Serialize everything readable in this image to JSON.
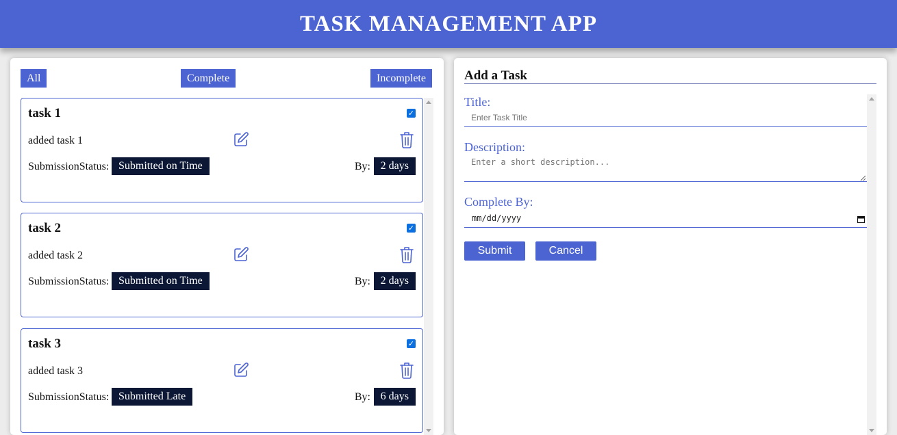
{
  "header": {
    "title": "TASK MANAGEMENT APP"
  },
  "filters": {
    "all": "All",
    "complete": "Complete",
    "incomplete": "Incomplete"
  },
  "tasks": [
    {
      "title": "task 1",
      "description": "added task 1",
      "completed": true,
      "status_label": "SubmissionStatus:",
      "status": "Submitted on Time",
      "by_label": "By:",
      "by": "2 days"
    },
    {
      "title": "task 2",
      "description": "added task 2",
      "completed": true,
      "status_label": "SubmissionStatus:",
      "status": "Submitted on Time",
      "by_label": "By:",
      "by": "2 days"
    },
    {
      "title": "task 3",
      "description": "added task 3",
      "completed": true,
      "status_label": "SubmissionStatus:",
      "status": "Submitted Late",
      "by_label": "By:",
      "by": "6 days"
    }
  ],
  "form": {
    "heading": "Add a Task",
    "title_label": "Title:",
    "title_placeholder": "Enter Task Title",
    "description_label": "Description:",
    "description_placeholder": "Enter a short description...",
    "complete_by_label": "Complete By:",
    "date_value": "mm/dd/yyyy",
    "submit_label": "Submit",
    "cancel_label": "Cancel"
  },
  "colors": {
    "accent": "#4c63d2",
    "badge": "#0b1735",
    "checkbox": "#0b6fdf"
  },
  "icons": {
    "edit": "edit-icon",
    "delete": "trash-icon",
    "calendar": "calendar-icon"
  }
}
